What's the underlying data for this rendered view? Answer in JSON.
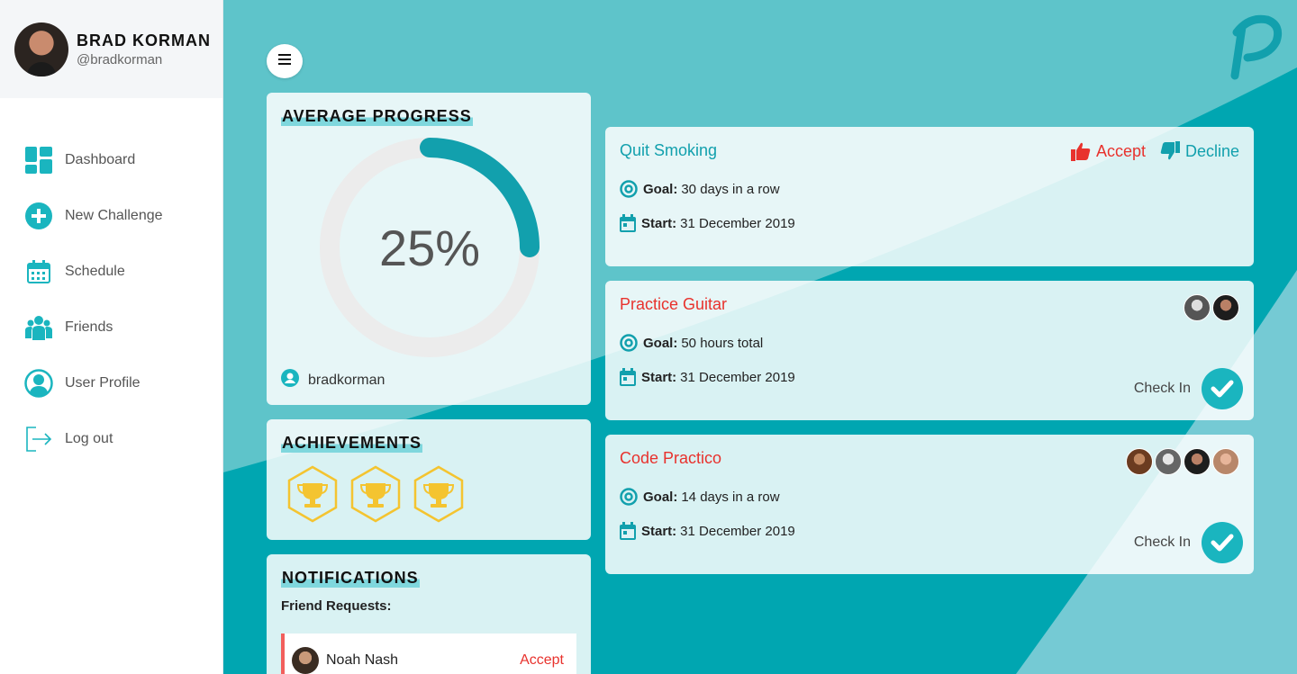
{
  "user": {
    "name": "BRAD KORMAN",
    "handle": "@bradkorman"
  },
  "nav": [
    {
      "label": "Dashboard",
      "icon": "dashboard-icon"
    },
    {
      "label": "New Challenge",
      "icon": "plus-circle-icon"
    },
    {
      "label": "Schedule",
      "icon": "calendar-icon"
    },
    {
      "label": "Friends",
      "icon": "friends-icon"
    },
    {
      "label": "User Profile",
      "icon": "user-icon"
    },
    {
      "label": "Log out",
      "icon": "logout-icon"
    }
  ],
  "progress": {
    "title": "AVERAGE PROGRESS",
    "value_text": "25%",
    "value": 0.25,
    "username": "bradkorman"
  },
  "achievements": {
    "title": "ACHIEVEMENTS",
    "count": 3
  },
  "notifications": {
    "title": "NOTIFICATIONS",
    "subtitle": "Friend Requests:",
    "requests": [
      {
        "name": "Noah Nash",
        "action": "Accept"
      }
    ]
  },
  "challenges": [
    {
      "title": "Quit Smoking",
      "goal_label": "Goal:",
      "goal": "30 days in a row",
      "start_label": "Start:",
      "start": "31 December 2019",
      "accept": "Accept",
      "decline": "Decline"
    },
    {
      "title": "Practice Guitar",
      "goal_label": "Goal:",
      "goal": "50 hours total",
      "start_label": "Start:",
      "start": "31 December 2019",
      "checkin": "Check In"
    },
    {
      "title": "Code Practico",
      "goal_label": "Goal:",
      "goal": "14 days in a row",
      "start_label": "Start:",
      "start": "31 December 2019",
      "checkin": "Check In"
    }
  ],
  "colors": {
    "primary": "#00a6b1",
    "accent": "#e8322d",
    "teal_text": "#12a0ad",
    "gold": "#f4c430"
  }
}
